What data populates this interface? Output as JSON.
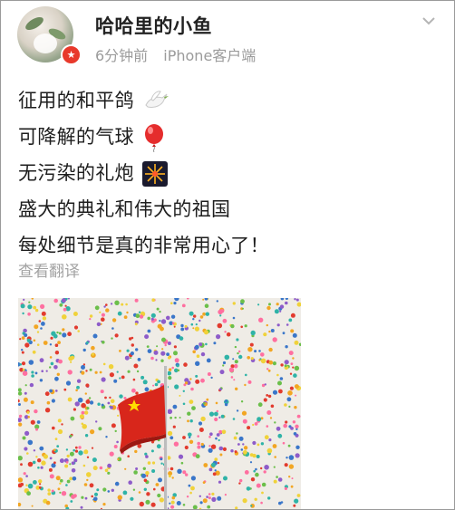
{
  "post": {
    "username": "哈哈里的小鱼",
    "time": "6分钟前",
    "source": "iPhone客户端",
    "badge_icon": "v-badge-icon",
    "menu_icon": "chevron-down-icon",
    "lines": [
      {
        "text": "征用的和平鸽",
        "emoji": "dove-icon"
      },
      {
        "text": "可降解的气球",
        "emoji": "balloon-icon"
      },
      {
        "text": "无污染的礼炮",
        "emoji": "fireworks-icon"
      },
      {
        "text": "盛大的典礼和伟大的祖国",
        "emoji": ""
      },
      {
        "text": "每处细节是真的非常用心了！",
        "emoji": ""
      }
    ],
    "translate_label": "查看翻译"
  },
  "colors": {
    "username": "#222222",
    "meta": "#9b9b9b",
    "badge": "#e8392b",
    "flag": "#d8261b"
  }
}
